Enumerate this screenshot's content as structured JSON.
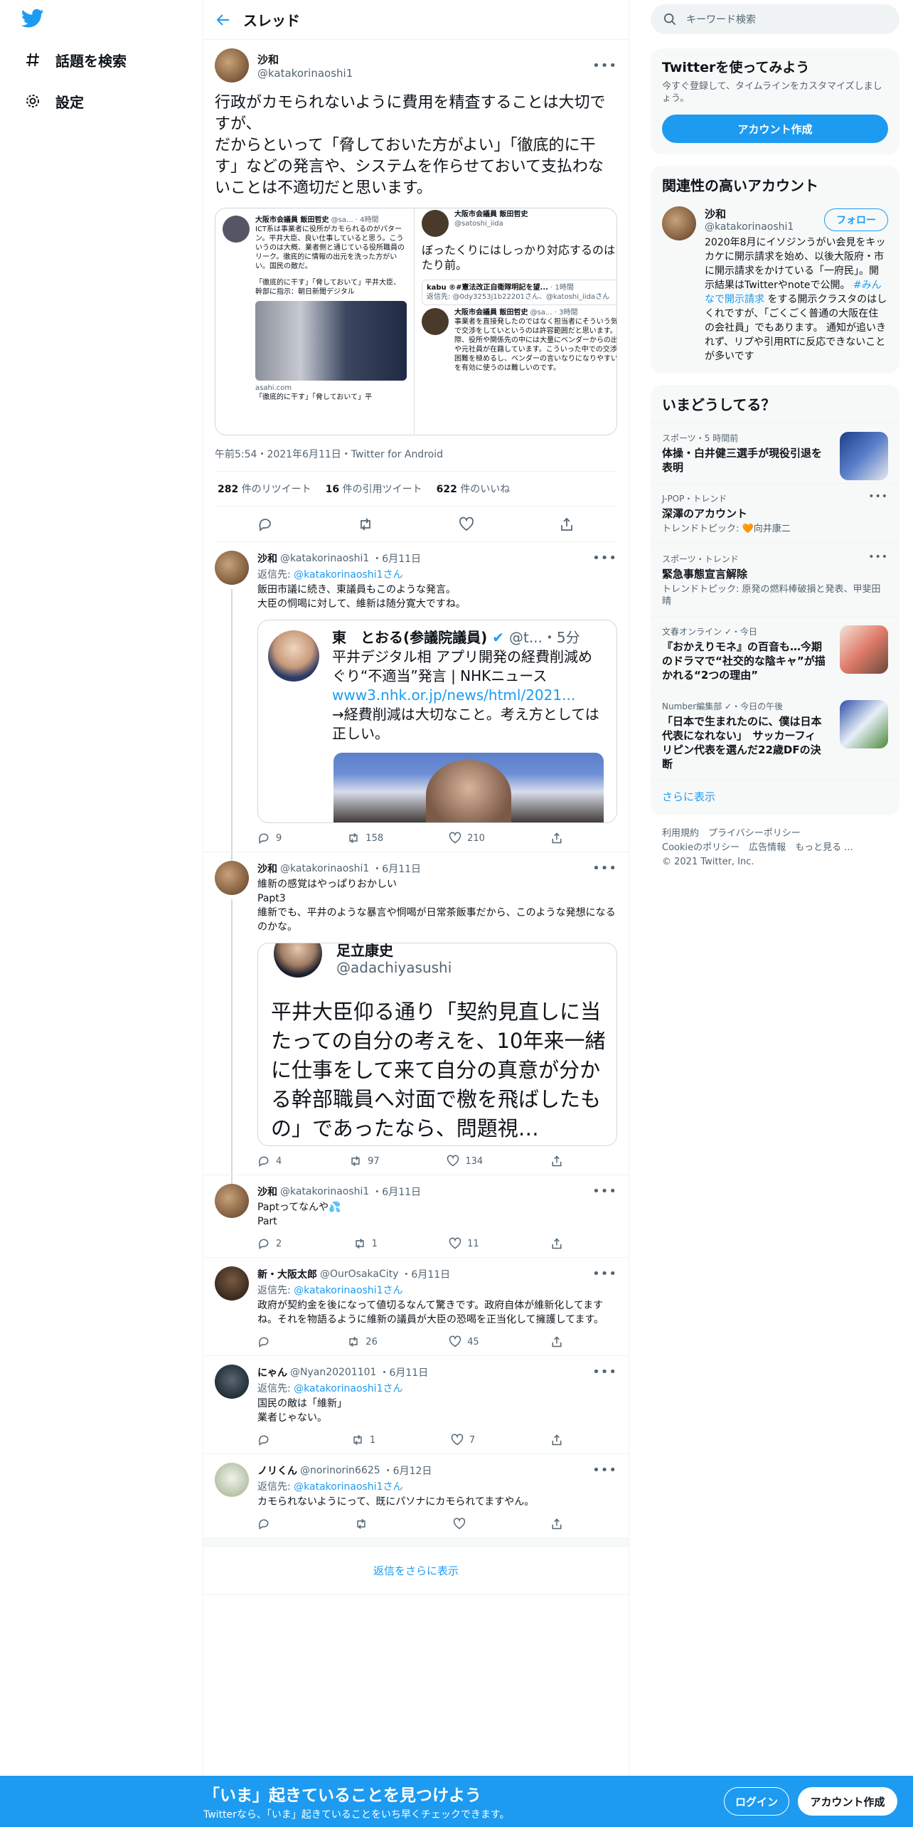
{
  "nav": {
    "explore": "話題を検索",
    "settings": "設定"
  },
  "header": {
    "title": "スレッド"
  },
  "main_tweet": {
    "name": "沙和",
    "handle": "@katakorinaoshi1",
    "text": "行政がカモられないように費用を精査することは大切ですが、\nだからといって「脅しておいた方がよい」「徹底的に干す」などの発言や、システムを作らせておいて支払わないことは不適切だと思います。",
    "image": {
      "left_name": "大阪市会議員 飯田哲史",
      "left_handle": "@sa...",
      "left_time": "4時間",
      "left_text": "ICT系は事業者に役所がカモられるのがパターン。平井大臣、良い仕事していると思う。こういうのは大概、業者側と通じている役所職員のリーク。徹底的に情報の出元を洗った方がいい。国民の敵だ。",
      "left_quote": "「徹底的に干す」「脅しておいて」平井大臣、幹部に指示：朝日新聞デジタル",
      "left_domain": "asahi.com",
      "left_bottom": "「徹底的に干す」「脅しておいて」平",
      "right_name": "大阪市会議員 飯田哲史",
      "right_handle": "@satoshi_iida",
      "right_text": "ぼったくりにはしっかり対応するのは当たり前。",
      "right_q_name": "kabu ®#憲法改正自衛隊明記を望...",
      "right_q_time": "1時間",
      "right_q_reply": "返信先: @0dy3253j1b22201さん、@katoshi_iidaさん",
      "right2_name": "大阪市会議員 飯田哲史",
      "right2_handle": "@sa...",
      "right2_time": "3時間",
      "right2_text": "事業者を直接発したのではなく担当者にそういう気構えで交渉をしていというのは許容範囲だと思います。実際、役所や関係先の中には大量にベンダーからの出向者や元社員が在籍しています。こういった中での交渉とは困難を極めるし、ベンダーの言いなりになりやすい。税を有効に使うのは難しいのです。"
    },
    "meta": "午前5:54・2021年6月11日・Twitter for Android",
    "retweets": "282",
    "retweets_label": "件のリツイート",
    "quotes": "16",
    "quotes_label": "件の引用ツイート",
    "likes": "622",
    "likes_label": "件のいいね"
  },
  "replies": [
    {
      "name": "沙和",
      "handle": "@katakorinaoshi1",
      "time": "・6月11日",
      "reply_to_prefix": "返信先: ",
      "reply_to": "@katakorinaoshi1さん",
      "text": "飯田市議に続き、東議員もこのような発言。\n大臣の恫喝に対して、維新は随分寛大ですね。",
      "embed": {
        "name": "東　とおる(参議院議員)",
        "handle": "@t...",
        "time": "・5分",
        "line1": "平井デジタル相 アプリ開発の経費削減めぐり“不適当”発言 | NHKニュース",
        "link": "www3.nhk.or.jp/news/html/2021...",
        "line2": "→経費削減は大切なこと。考え方としては正しい。"
      },
      "replies": "9",
      "retweets": "158",
      "likes": "210"
    },
    {
      "name": "沙和",
      "handle": "@katakorinaoshi1",
      "time": "・6月11日",
      "text": "維新の感覚はやっぱりおかしい\nPapt3\n維新でも、平井のような暴言や恫喝が日常茶飯事だから、このような発想になるのかな。",
      "embed": {
        "name": "足立康史",
        "handle": "@adachiyasushi",
        "text": "平井大臣仰る通り「契約見直しに当たっての自分の考えを、10年来一緒に仕事をして来て自分の真意が分かる幹部職員へ対面で檄を飛ばしたもの」であったなら、問題視…"
      },
      "replies": "4",
      "retweets": "97",
      "likes": "134"
    },
    {
      "name": "沙和",
      "handle": "@katakorinaoshi1",
      "time": "・6月11日",
      "text": "Paptってなんや💦\nPart",
      "replies": "2",
      "retweets": "1",
      "likes": "11"
    },
    {
      "name": "新・大阪太郎",
      "handle": "@OurOsakaCity",
      "time": "・6月11日",
      "reply_to_prefix": "返信先: ",
      "reply_to": "@katakorinaoshi1さん",
      "text": "政府が契約金を後になって値切るなんて驚きです。政府自体が維新化してますね。それを物語るように維新の議員が大臣の恐喝を正当化して擁護してます。",
      "replies": "",
      "retweets": "26",
      "likes": "45"
    },
    {
      "name": "にゃん",
      "handle": "@Nyan20201101",
      "time": "・6月11日",
      "reply_to_prefix": "返信先: ",
      "reply_to": "@katakorinaoshi1さん",
      "text": "国民の敵は「維新」\n業者じゃない。",
      "replies": "",
      "retweets": "1",
      "likes": "7"
    },
    {
      "name": "ノリくん",
      "handle": "@norinorin6625",
      "time": "・6月12日",
      "reply_to_prefix": "返信先: ",
      "reply_to": "@katakorinaoshi1さん",
      "text": "カモられないようにって、既にパソナにカモられてますやん。",
      "replies": "",
      "retweets": "",
      "likes": ""
    }
  ],
  "show_more_replies": "返信をさらに表示",
  "right": {
    "search_placeholder": "キーワード検索",
    "signup_title": "Twitterを使ってみよう",
    "signup_text": "今すぐ登録して、タイムラインをカスタマイズしましょう。",
    "signup_button": "アカウント作成",
    "related_title": "関連性の高いアカウント",
    "related_name": "沙和",
    "related_handle": "@katakorinaoshi1",
    "follow": "フォロー",
    "related_bio_1": "2020年8月にイソジンうがい会見をキッカケに開示請求を始め、以後大阪府・市に開示請求をかけている「一府民」。開示結果はTwitterやnoteで公開。",
    "related_bio_tag": "#みんなで開示請求",
    "related_bio_2": "をする開示クラスタのはしくれですが、「ごくごく普通の大阪在住の会社員」でもあります。 通知が追いきれず、リプや引用RTに反応できないことが多いです",
    "trends_title": "いまどうしてる？",
    "trends": [
      {
        "cat": "スポーツ・5 時間前",
        "title": "体操・白井健三選手が現役引退を表明",
        "sub": "",
        "thumb": true
      },
      {
        "cat": "J-POP・トレンド",
        "title": "深澤のアカウント",
        "sub": "トレンドトピック: 🧡向井康二",
        "thumb": false
      },
      {
        "cat": "スポーツ・トレンド",
        "title": "緊急事態宣言解除",
        "sub": "トレンドトピック: 原発の燃料棒破損と発表、甲斐田晴",
        "thumb": false
      },
      {
        "cat": "文春オンライン ✓・今日",
        "title": "『おかえりモネ』の百音も…今期のドラマで“社交的な陰キャ”が描かれる“2つの理由”",
        "sub": "",
        "thumb": true
      },
      {
        "cat": "Number編集部 ✓・今日の午後",
        "title": "「日本で生まれたのに、僕は日本代表になれない」　サッカーフィリピン代表を選んだ22歳DFの決断",
        "sub": "",
        "thumb": true
      }
    ],
    "show_more": "さらに表示",
    "footer1": "利用規約　プライバシーポリシー",
    "footer2": "Cookieのポリシー　広告情報　もっと見る ...",
    "footer3": "© 2021 Twitter, Inc."
  },
  "bottom": {
    "title": "「いま」起きていることを見つけよう",
    "subtitle": "Twitterなら、「いま」起きていることをいち早くチェックできます。",
    "login": "ログイン",
    "signup": "アカウント作成"
  }
}
